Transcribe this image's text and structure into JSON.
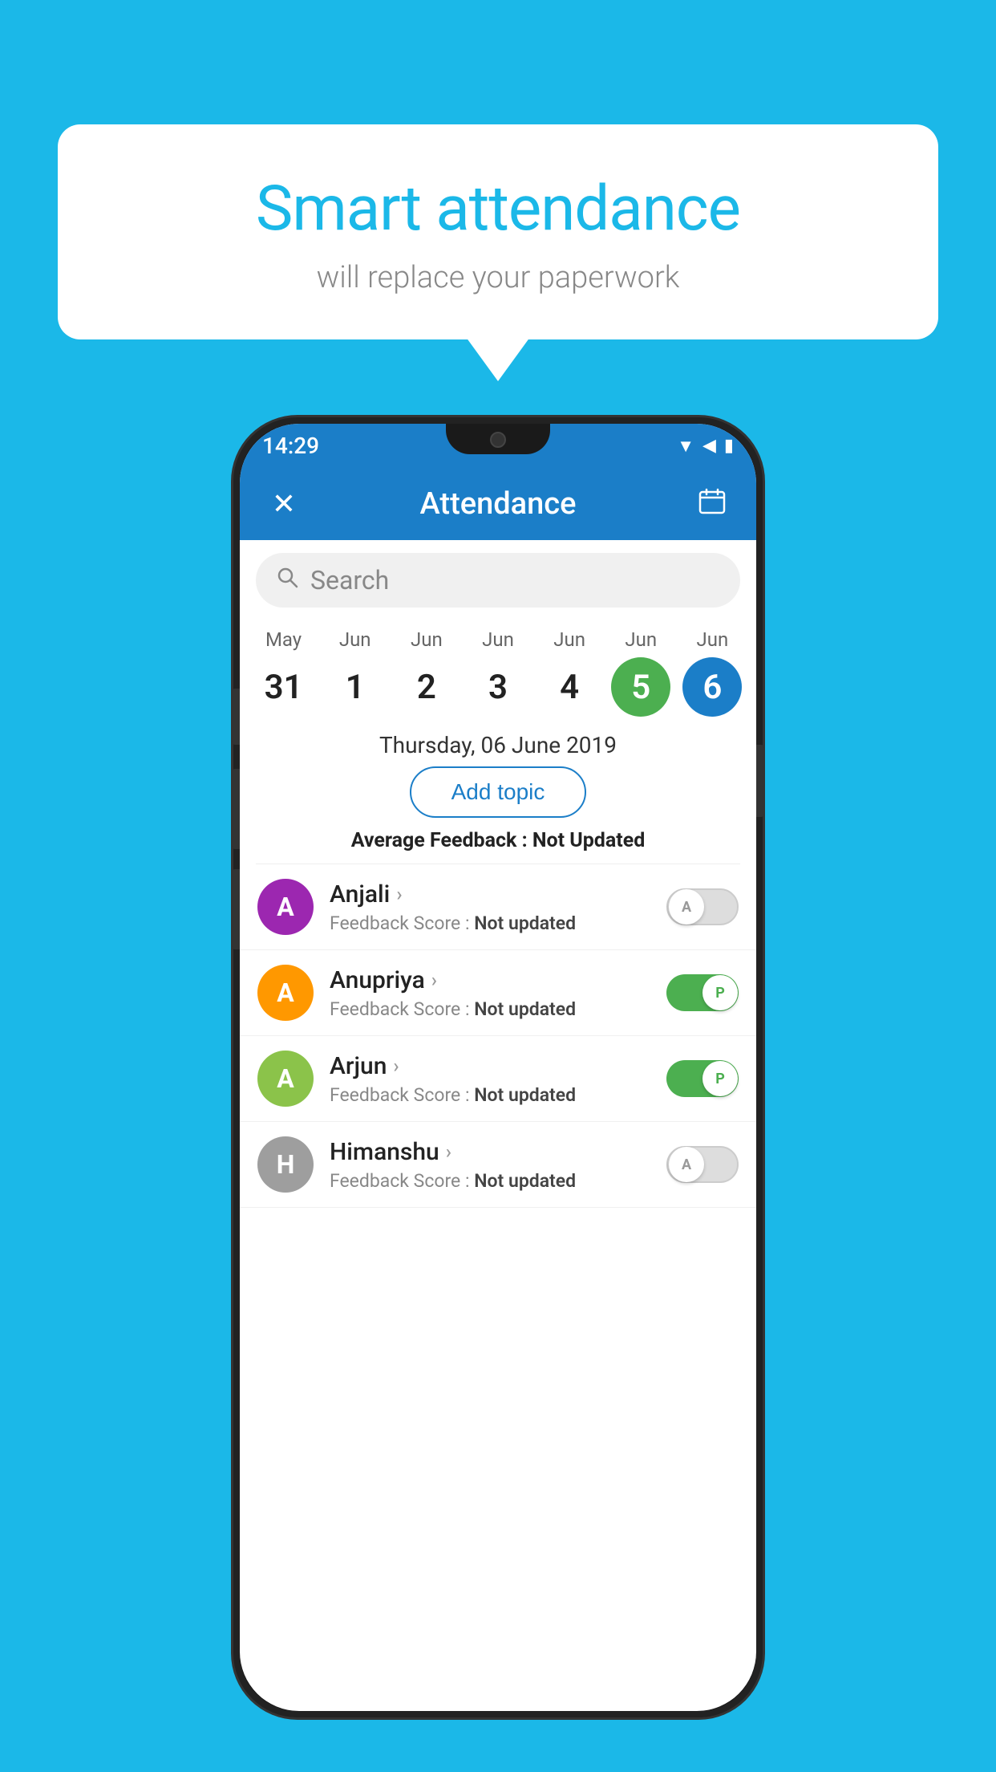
{
  "background_color": "#1BB8E8",
  "speech_bubble": {
    "title": "Smart attendance",
    "subtitle": "will replace your paperwork"
  },
  "status_bar": {
    "time": "14:29",
    "icons": [
      "wifi",
      "signal",
      "battery"
    ]
  },
  "app_bar": {
    "title": "Attendance",
    "close_label": "✕",
    "calendar_label": "📅"
  },
  "search": {
    "placeholder": "Search"
  },
  "calendar": {
    "days": [
      {
        "month": "May",
        "date": "31",
        "state": "normal"
      },
      {
        "month": "Jun",
        "date": "1",
        "state": "normal"
      },
      {
        "month": "Jun",
        "date": "2",
        "state": "normal"
      },
      {
        "month": "Jun",
        "date": "3",
        "state": "normal"
      },
      {
        "month": "Jun",
        "date": "4",
        "state": "normal"
      },
      {
        "month": "Jun",
        "date": "5",
        "state": "today"
      },
      {
        "month": "Jun",
        "date": "6",
        "state": "selected"
      }
    ]
  },
  "selected_date": "Thursday, 06 June 2019",
  "add_topic_label": "Add topic",
  "avg_feedback_label": "Average Feedback : ",
  "avg_feedback_value": "Not Updated",
  "students": [
    {
      "name": "Anjali",
      "avatar_letter": "A",
      "avatar_color": "#9C27B0",
      "feedback_label": "Feedback Score : ",
      "feedback_value": "Not updated",
      "toggle_state": "off",
      "toggle_letter": "A"
    },
    {
      "name": "Anupriya",
      "avatar_letter": "A",
      "avatar_color": "#FF9800",
      "feedback_label": "Feedback Score : ",
      "feedback_value": "Not updated",
      "toggle_state": "on",
      "toggle_letter": "P"
    },
    {
      "name": "Arjun",
      "avatar_letter": "A",
      "avatar_color": "#8BC34A",
      "feedback_label": "Feedback Score : ",
      "feedback_value": "Not updated",
      "toggle_state": "on",
      "toggle_letter": "P"
    },
    {
      "name": "Himanshu",
      "avatar_letter": "H",
      "avatar_color": "#9E9E9E",
      "feedback_label": "Feedback Score : ",
      "feedback_value": "Not updated",
      "toggle_state": "off",
      "toggle_letter": "A"
    }
  ]
}
